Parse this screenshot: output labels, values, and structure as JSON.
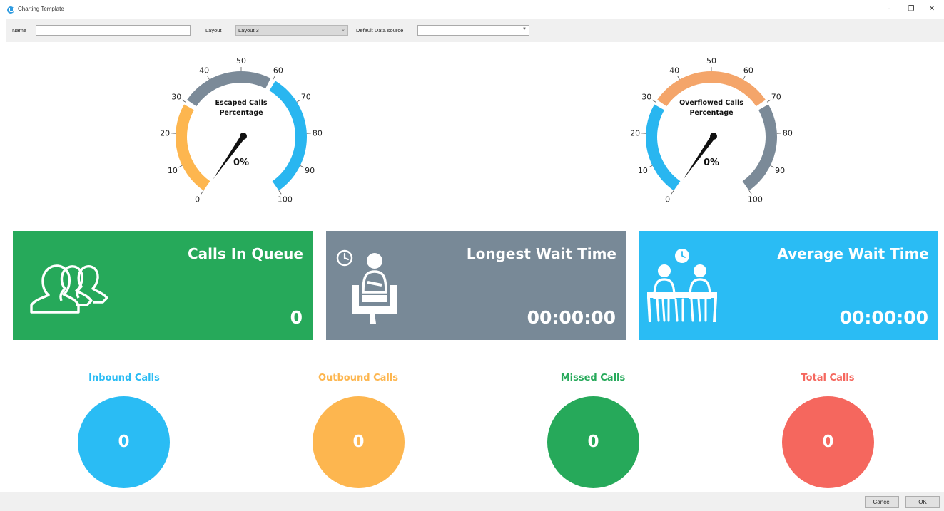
{
  "window": {
    "title": "Charting Template",
    "minimize_glyph": "–",
    "restore_glyph": "❐",
    "close_glyph": "✕"
  },
  "toolbar": {
    "name_label": "Name",
    "name_value": "",
    "layout_label": "Layout",
    "layout_value": "Layout 3",
    "datasource_label": "Default Data source",
    "datasource_value": ""
  },
  "gauges": [
    {
      "title_line1": "Escaped Calls",
      "title_line2": "Percentage",
      "value_text": "0%",
      "value": 0,
      "ticks": [
        "0",
        "10",
        "20",
        "30",
        "40",
        "50",
        "60",
        "70",
        "80",
        "90",
        "100"
      ],
      "bands": [
        {
          "from": 0,
          "to": 30,
          "color": "#fdb64f"
        },
        {
          "from": 30,
          "to": 60,
          "color": "#7b8a98"
        },
        {
          "from": 60,
          "to": 100,
          "color": "#29b6f0"
        }
      ]
    },
    {
      "title_line1": "Overflowed Calls",
      "title_line2": "Percentage",
      "value_text": "0%",
      "value": 0,
      "ticks": [
        "0",
        "10",
        "20",
        "30",
        "40",
        "50",
        "60",
        "70",
        "80",
        "90",
        "100"
      ],
      "bands": [
        {
          "from": 0,
          "to": 30,
          "color": "#29b6f0"
        },
        {
          "from": 30,
          "to": 70,
          "color": "#f4a56a"
        },
        {
          "from": 70,
          "to": 100,
          "color": "#7b8a98"
        }
      ]
    }
  ],
  "tiles": [
    {
      "title": "Calls In Queue",
      "value": "0",
      "color": "#26a95a",
      "icon": "group-icon"
    },
    {
      "title": "Longest Wait Time",
      "value": "00:00:00",
      "color": "#788997",
      "icon": "waiting-person-icon"
    },
    {
      "title": "Average Wait Time",
      "value": "00:00:00",
      "color": "#2abcf4",
      "icon": "waiting-people-icon"
    }
  ],
  "stats": [
    {
      "label": "Inbound Calls",
      "value": "0",
      "color": "#2abcf4"
    },
    {
      "label": "Outbound Calls",
      "value": "0",
      "color": "#fdb64f"
    },
    {
      "label": "Missed Calls",
      "value": "0",
      "color": "#26a95a"
    },
    {
      "label": "Total Calls",
      "value": "0",
      "color": "#f5675e"
    }
  ],
  "footer": {
    "cancel_label": "Cancel",
    "ok_label": "OK"
  }
}
